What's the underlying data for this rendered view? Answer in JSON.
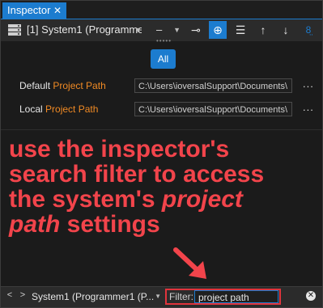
{
  "tab": {
    "title": "Inspector",
    "close_glyph": "✕"
  },
  "toolbar": {
    "system_select": "[1] System1 (Programme",
    "minus_select": "–",
    "buttons": [
      {
        "icon": "pin-icon",
        "glyph": "⊸"
      },
      {
        "icon": "crosshair-icon",
        "glyph": "⊕",
        "active": true
      },
      {
        "icon": "list-icon",
        "glyph": "☰"
      },
      {
        "icon": "arrow-up-icon",
        "glyph": "🠕"
      },
      {
        "icon": "arrow-down-icon",
        "glyph": "🠗"
      },
      {
        "icon": "filter-options-icon",
        "glyph": "⁂"
      }
    ]
  },
  "all_button": "All",
  "rows": [
    {
      "prefix": "Default",
      "name": "Project Path",
      "value": "C:\\Users\\ioversalSupport\\Documents\\",
      "more": "..."
    },
    {
      "prefix": "Local",
      "name": "Project Path",
      "value": "C:\\Users\\ioversalSupport\\Documents\\",
      "more": "..."
    }
  ],
  "annotation": {
    "line1": "use the inspector's",
    "line2": "search filter to access",
    "line3_a": "the system's ",
    "line3_b": "project",
    "line4_a": "path",
    "line4_b": " settings"
  },
  "bottom": {
    "prev": "<",
    "next": ">",
    "system": "System1 (Programmer1 (P...",
    "filter_label": "Filter:",
    "filter_value": "project path",
    "clear_glyph": "✕"
  },
  "colors": {
    "accent": "#1c7ccf",
    "highlight": "#f08a24",
    "annotation": "#f2444b"
  }
}
